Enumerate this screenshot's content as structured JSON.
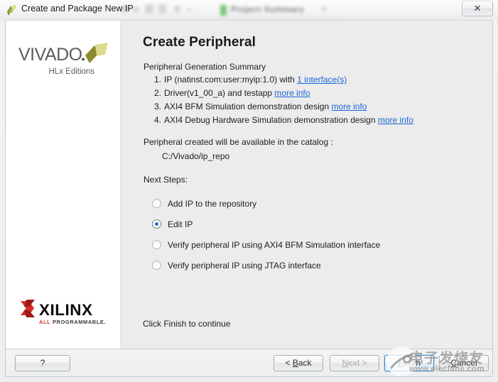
{
  "window": {
    "title": "Create and Package New IP",
    "icon": "vivado-logo-icon",
    "close_label": "✕",
    "backdrop_tab_label": "Project Summary",
    "backdrop_tab_close": "✕"
  },
  "sidebar": {
    "product_name": "VIVADO",
    "product_name_suffix": ".",
    "product_edition": "HLx Editions",
    "vendor_name": "XILINX",
    "vendor_tagline": "ALL PROGRAMMABLE",
    "vendor_tagline_accent": "ALL",
    "vendor_tagline_rest": " PROGRAMMABLE"
  },
  "main": {
    "page_title": "Create Peripheral",
    "summary_label": "Peripheral Generation Summary",
    "summary_items": [
      {
        "number": "1.",
        "text_before": "IP (natinst.com:user:myip:1.0) with ",
        "link": "1 interface(s)",
        "text_after": ""
      },
      {
        "number": "2.",
        "text_before": "Driver(v1_00_a) and testapp ",
        "link": "more info",
        "text_after": ""
      },
      {
        "number": "3.",
        "text_before": "AXI4 BFM Simulation demonstration design ",
        "link": "more info",
        "text_after": ""
      },
      {
        "number": "4.",
        "text_before": "AXI4 Debug Hardware Simulation demonstration design ",
        "link": "more info",
        "text_after": ""
      }
    ],
    "catalog_label": "Peripheral created will be available in the catalog :",
    "catalog_path": "C:/Vivado/ip_repo",
    "next_steps_label": "Next Steps:",
    "next_steps_options": [
      {
        "label": "Add IP to the repository",
        "selected": false
      },
      {
        "label": "Edit IP",
        "selected": true
      },
      {
        "label": "Verify peripheral IP using AXI4 BFM Simulation interface",
        "selected": false
      },
      {
        "label": "Verify peripheral IP using JTAG interface",
        "selected": false
      }
    ],
    "finish_hint": "Click Finish to continue"
  },
  "footer": {
    "help_label": "?",
    "back_label": "< Back",
    "back_mnemonic": "B",
    "next_label": "Next >",
    "next_mnemonic": "N",
    "next_enabled": false,
    "finish_label": "Finish",
    "finish_mnemonic": "F",
    "finish_primary": true,
    "cancel_label": "Cancel",
    "cancel_mnemonic": "C"
  },
  "watermark": {
    "chinese_text": "电子发烧友",
    "url_text": "www.elecfans.com"
  },
  "colors": {
    "link": "#1a66d6",
    "content_bg": "#ececec",
    "sidebar_bg": "#ffffff",
    "radio_accent": "#2f6fba",
    "primary_button_border": "#3c88c8",
    "vivado_olive": "#8c8c2e",
    "vivado_light": "#d8d884",
    "xilinx_red": "#d42e27",
    "xilinx_dark_red": "#9c1b18",
    "tab_green": "#5fc05f"
  }
}
